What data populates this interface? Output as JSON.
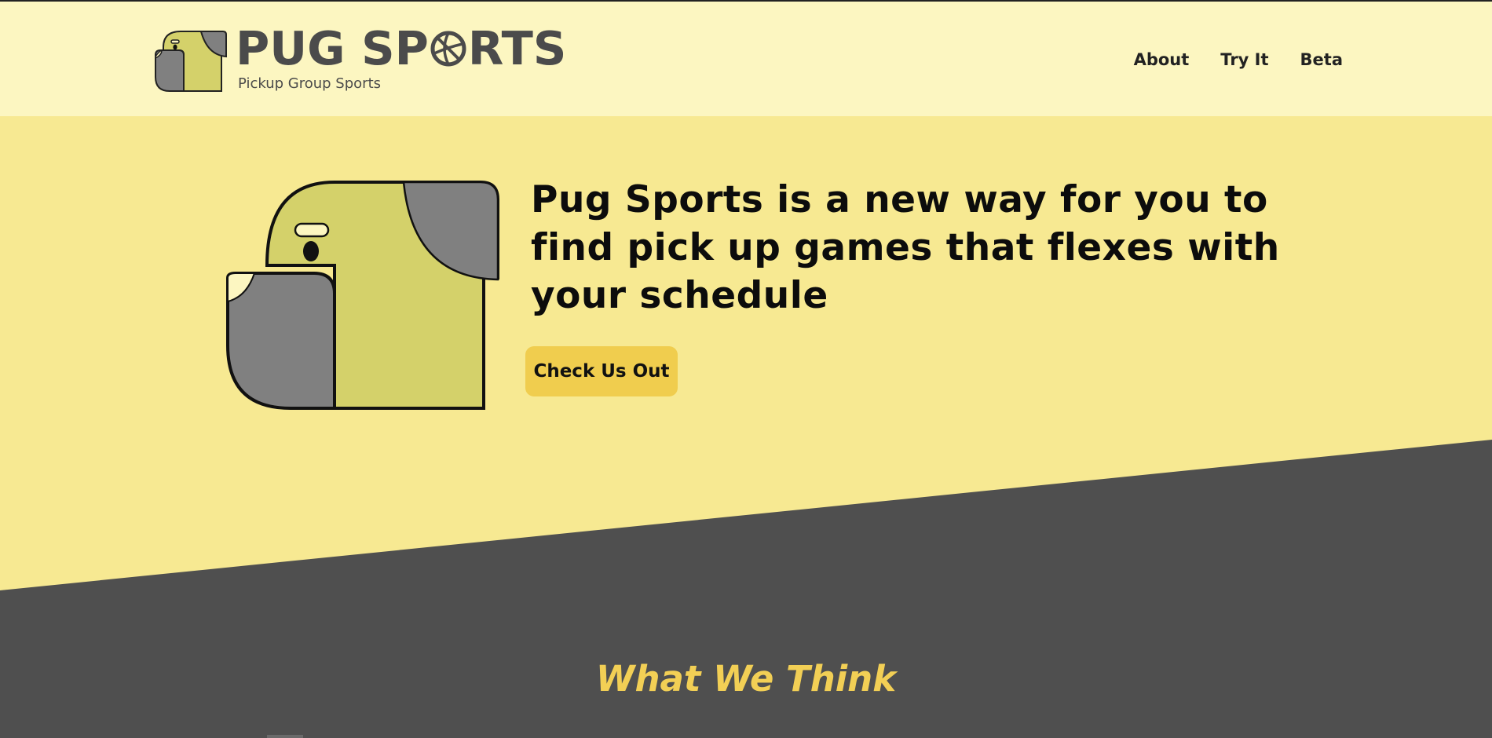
{
  "brand": {
    "title_pre": "PUG SP",
    "title_post": "RTS",
    "subtitle": "Pickup Group Sports",
    "logo_icon": "pug-logo-icon",
    "ball_icon": "basketball-icon"
  },
  "nav": {
    "items": [
      {
        "label": "About"
      },
      {
        "label": "Try It"
      },
      {
        "label": "Beta"
      }
    ]
  },
  "hero": {
    "heading": "Pug Sports is a new way for you to find pick up games that flexes with your schedule",
    "cta_label": "Check Us Out",
    "illustration_icon": "pug-mascot-icon"
  },
  "section": {
    "title": "What We Think"
  },
  "colors": {
    "header_bg": "#fcf6c1",
    "hero_bg": "#f7e992",
    "dark_bg": "#4f4f4f",
    "accent": "#f0cd4e",
    "pug_body": "#d4d16a",
    "pug_ear": "#808080",
    "title_accent": "#f2cf55"
  }
}
